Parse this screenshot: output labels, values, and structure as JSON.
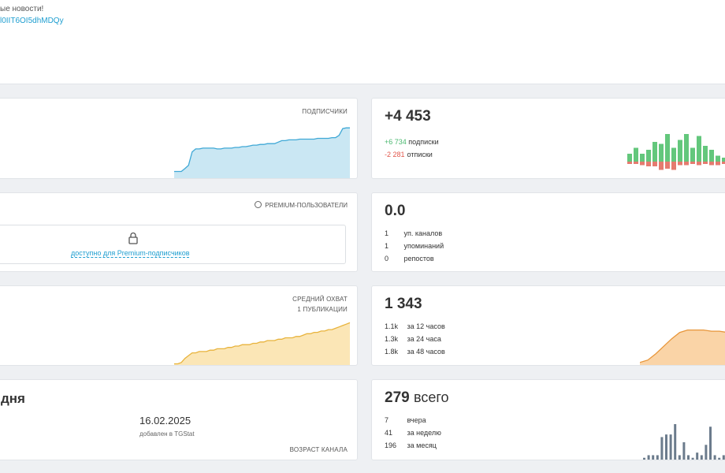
{
  "header": {
    "news_text": "ые новости!",
    "link_text": "l0IIT6OI5dhMDQy"
  },
  "subscribers_chart": {
    "label": "подписчики",
    "chart_data": {
      "type": "area",
      "values": [
        10,
        10,
        10,
        14,
        18,
        36,
        40,
        40,
        41,
        41,
        41,
        41,
        40,
        40,
        41,
        41,
        41,
        42,
        42,
        43,
        43,
        44,
        45,
        45,
        46,
        46,
        47,
        47,
        47,
        49,
        51,
        51,
        52,
        52,
        52,
        53,
        53,
        53,
        53,
        53,
        54,
        54,
        54,
        54,
        55,
        55,
        58,
        67,
        68,
        68
      ],
      "color": "#9fd3ea"
    }
  },
  "subscribers_summary": {
    "total": "+4 453",
    "subscribed_value": "+6 734",
    "subscribed_label": "подписки",
    "unsubscribed_value": "-2 281",
    "unsubscribed_label": "отписки",
    "chart_data": {
      "type": "bar",
      "positive": [
        4,
        7,
        4,
        6,
        10,
        9,
        14,
        7,
        11,
        14,
        7,
        13,
        8,
        6,
        3,
        2
      ],
      "negative": [
        2,
        2,
        3,
        4,
        4,
        7,
        6,
        7,
        3,
        3,
        2,
        3,
        2,
        3,
        3,
        2
      ],
      "positive_color": "#63c77c",
      "negative_color": "#e57a6f"
    }
  },
  "premium": {
    "label": "premium-пользователи",
    "lock_link": "доступно для Premium-подписчиков"
  },
  "citations": {
    "index": "0.0",
    "rows": [
      {
        "value": "1",
        "label": "уп. каналов"
      },
      {
        "value": "1",
        "label": "упоминаний"
      },
      {
        "value": "0",
        "label": "репостов"
      }
    ]
  },
  "reach_chart": {
    "label_line1": "средний охват",
    "label_line2": "1 публикации",
    "chart_data": {
      "type": "area",
      "values": [
        2,
        2,
        3,
        6,
        8,
        10,
        10,
        11,
        11,
        11,
        12,
        12,
        13,
        13,
        13,
        14,
        14,
        15,
        15,
        16,
        16,
        16,
        17,
        17,
        18,
        18,
        19,
        19,
        19,
        20,
        20,
        21,
        21,
        21,
        22,
        22,
        23,
        24,
        24,
        25,
        25,
        26,
        26,
        27,
        27,
        28,
        29,
        30,
        31,
        32
      ],
      "color": "#f7d27a"
    }
  },
  "reach_summary": {
    "total": "1 343",
    "rows": [
      {
        "value": "1.1k",
        "label": "за 12 часов"
      },
      {
        "value": "1.3k",
        "label": "за 24 часа"
      },
      {
        "value": "1.8k",
        "label": "за 48 часов"
      }
    ],
    "chart_data": {
      "type": "area",
      "values": [
        2,
        4,
        9,
        15,
        21,
        26,
        28,
        28,
        28,
        27,
        27,
        26
      ],
      "color": "#f6b15e"
    }
  },
  "channel_age": {
    "age_text": "дня",
    "date": "16.02.2025",
    "date_caption": "добавлен в TGStat",
    "label": "возраст канала"
  },
  "posts": {
    "total_value": "279",
    "total_label": "всего",
    "rows": [
      {
        "value": "7",
        "label": "вчера"
      },
      {
        "value": "41",
        "label": "за неделю"
      },
      {
        "value": "196",
        "label": "за месяц"
      }
    ],
    "chart_data": {
      "type": "bar",
      "values": [
        1,
        2,
        2,
        2,
        9,
        10,
        10,
        14,
        2,
        7,
        2,
        1,
        3,
        2,
        6,
        13,
        2,
        1,
        2
      ],
      "color": "#6b7b8c"
    }
  }
}
